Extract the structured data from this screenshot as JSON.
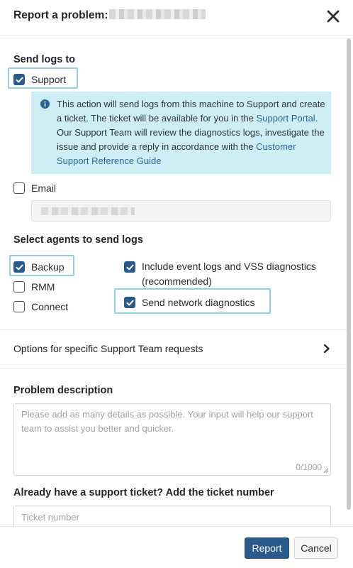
{
  "dialog": {
    "title": "Report a problem:",
    "close_icon": "close-icon"
  },
  "send_logs": {
    "heading": "Send logs to",
    "support_label": "Support",
    "support_checked": true,
    "info": {
      "icon": "info-icon",
      "text_1": "This action will send logs from this machine to Support and create a ticket. The ticket will be available for you in the ",
      "link_1": "Support Portal",
      "text_2": ". Our Support Team will review the diagnostics logs, investigate the issue and provide a reply in accordance with the ",
      "link_2": "Customer Support Reference Guide"
    },
    "email_label": "Email",
    "email_checked": false
  },
  "agents": {
    "heading": "Select agents to send logs",
    "backup_label": "Backup",
    "backup_checked": true,
    "rmm_label": "RMM",
    "rmm_checked": false,
    "connect_label": "Connect",
    "connect_checked": false,
    "event_logs_label_1": "Include event logs and VSS diagnostics",
    "event_logs_label_2": "(recommended)",
    "event_logs_checked": true,
    "network_label": "Send network diagnostics",
    "network_checked": true
  },
  "options": {
    "label": "Options for specific Support Team requests",
    "icon": "chevron-right-icon"
  },
  "problem": {
    "heading": "Problem description",
    "placeholder": "Please add as many details as possible. Your input will help our support team to assist you better and quicker.",
    "counter": "0/1000"
  },
  "ticket": {
    "heading": "Already have a support ticket? Add the ticket number",
    "placeholder": "Ticket number"
  },
  "footer": {
    "report_label": "Report",
    "cancel_label": "Cancel"
  },
  "colors": {
    "accent": "#2a5a8c",
    "highlight": "#8fd0e2",
    "info_bg": "#cdeef5",
    "link": "#2a6496"
  }
}
